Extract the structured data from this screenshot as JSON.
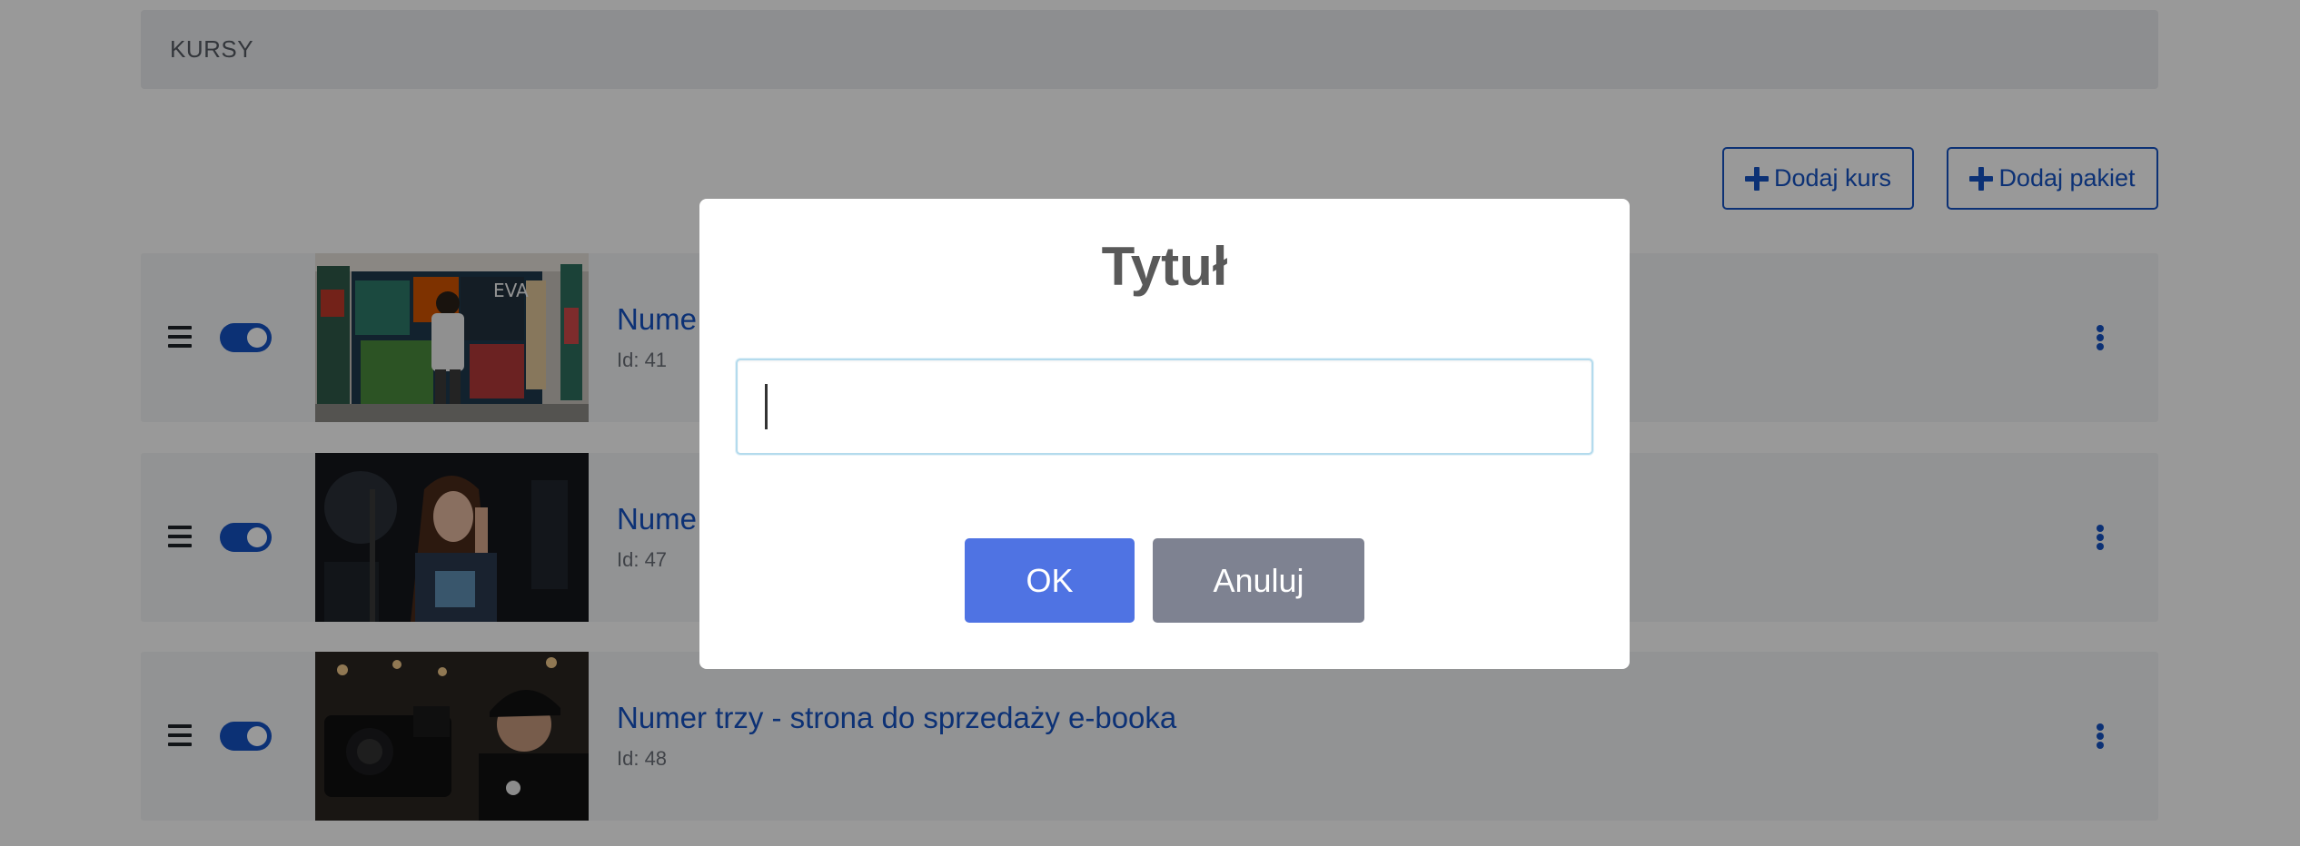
{
  "header": {
    "title": "KURSY"
  },
  "actions": {
    "add_course_label": "Dodaj kurs",
    "add_package_label": "Dodaj pakiet"
  },
  "courses": [
    {
      "title": "Nume",
      "id_label": "Id: 41",
      "enabled": true
    },
    {
      "title": "Nume",
      "id_label": "Id: 47",
      "enabled": true
    },
    {
      "title": "Numer trzy - strona do sprzedaży e-booka",
      "id_label": "Id: 48",
      "enabled": true
    }
  ],
  "dialog": {
    "title": "Tytuł",
    "input_value": "",
    "ok_label": "OK",
    "cancel_label": "Anuluj"
  },
  "colors": {
    "accent": "#1552c4",
    "ok_button": "#4f73e3",
    "cancel_button": "#7e8291",
    "row_background": "#f4f5f7",
    "overlay": "rgba(0,0,0,0.4)"
  },
  "icons": [
    "plus-icon",
    "drag-handle-icon",
    "kebab-menu-icon"
  ]
}
